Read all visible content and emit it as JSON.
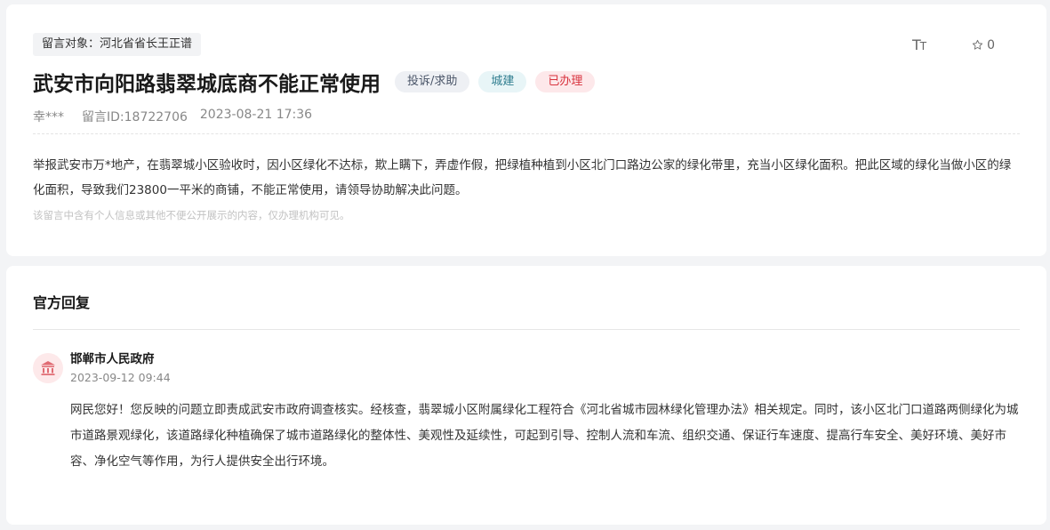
{
  "message": {
    "target_label": "留言对象：河北省省长王正谱",
    "title": "武安市向阳路翡翠城底商不能正常使用",
    "tags": [
      "投诉/求助",
      "城建",
      "已办理"
    ],
    "author": "幸***",
    "message_id": "留言ID:18722706",
    "time": "2023-08-21 17:36",
    "content": "举报武安市万*地产，在翡翠城小区验收时，因小区绿化不达标，欺上瞒下，弄虚作假，把绿植种植到小区北门口路边公家的绿化带里，充当小区绿化面积。把此区域的绿化当做小区的绿化面积，导致我们23800一平米的商铺，不能正常使用，请领导协助解决此问题。",
    "privacy_note": "该留言中含有个人信息或其他不便公开展示的内容，仅办理机构可见。"
  },
  "toolbar": {
    "font_size_icon": "font-size-icon",
    "star_icon": "star-icon",
    "star_count": "0"
  },
  "reply": {
    "section_title": "官方回复",
    "avatar_icon": "government-building-icon",
    "responder": "邯郸市人民政府",
    "time": "2023-09-12 09:44",
    "content": "网民您好！您反映的问题立即责成武安市政府调查核实。经核查，翡翠城小区附属绿化工程符合《河北省城市园林绿化管理办法》相关规定。同时，该小区北门口道路两侧绿化为城市道路景观绿化，该道路绿化种植确保了城市道路绿化的整体性、美观性及延续性，可起到引导、控制人流和车流、组织交通、保证行车速度、提高行车安全、美好环境、美好市容、净化空气等作用，为行人提供安全出行环境。"
  },
  "colors": {
    "tag_gray": "#eef0f4",
    "tag_cyan": "#e8f5f7",
    "tag_red": "#fde8ea",
    "accent_red": "#d8323d"
  }
}
